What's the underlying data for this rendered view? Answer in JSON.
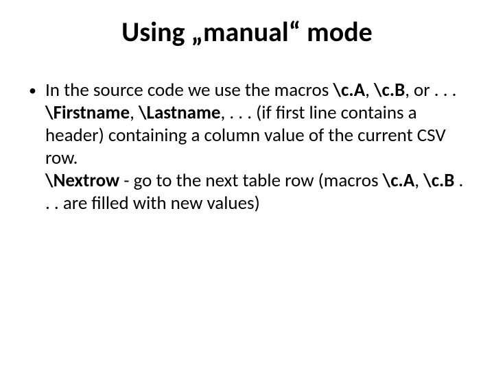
{
  "slide": {
    "title": "Using „manual“ mode",
    "bullet": {
      "marker": "•",
      "t1": "In the source code we use the macros ",
      "m1": "\\c.A",
      "t2": ", ",
      "m2": "\\c.B",
      "t3": ", or . . . ",
      "m3": "\\Firstname",
      "t4": ", ",
      "m4": "\\Lastname",
      "t5": ", . . . (if first line contains a header) containing a column value of the current CSV row.",
      "br": "",
      "m5": "\\Nextrow",
      "t6": " - go to the next table row (macros ",
      "m6": "\\c.A",
      "t7": ", ",
      "m7": "\\c.B",
      "t8": " . . . are filled with new values)"
    }
  }
}
